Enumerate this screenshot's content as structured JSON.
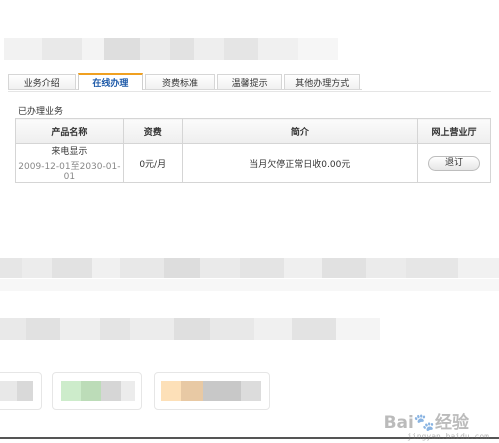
{
  "tabs": [
    {
      "label": "业务介绍",
      "active": false
    },
    {
      "label": "在线办理",
      "active": true
    },
    {
      "label": "资费标准",
      "active": false
    },
    {
      "label": "温馨提示",
      "active": false
    },
    {
      "label": "其他办理方式",
      "active": false
    }
  ],
  "section_title": "已办理业务",
  "table": {
    "headers": [
      "产品名称",
      "资费",
      "简介",
      "网上营业厅"
    ],
    "rows": [
      {
        "name": "来电显示",
        "date_range": "2009-12-01至2030-01-01",
        "fee": "0元/月",
        "intro": "当月欠停正常日收0.00元",
        "action": "退订"
      }
    ]
  },
  "watermark": {
    "text": "Bai🐾经验",
    "url": "jingyan.baidu.com"
  },
  "colors": {
    "active_tab_text": "#1e5aa8",
    "active_tab_top": "#f0a020",
    "border": "#d5d5d5"
  }
}
